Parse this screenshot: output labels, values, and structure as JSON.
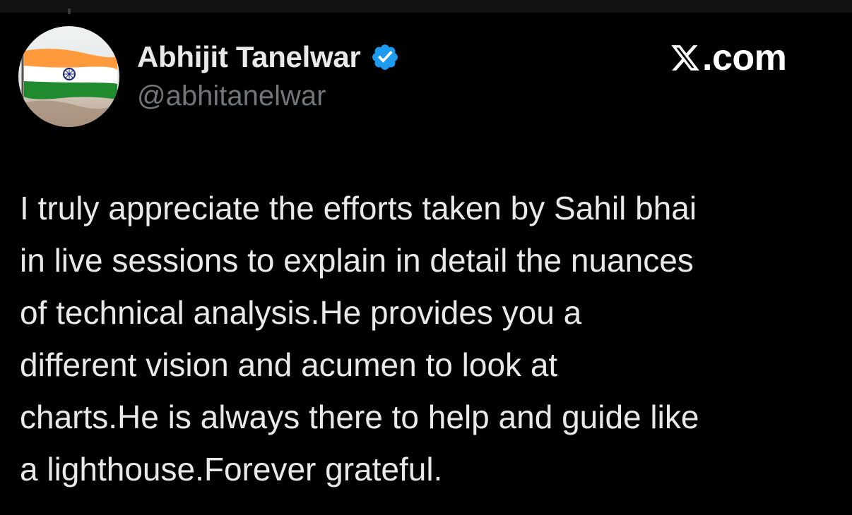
{
  "author": {
    "display_name": "Abhijit Tanelwar",
    "handle": "@abhitanelwar",
    "verified": true,
    "verified_icon": "verified-badge-icon",
    "avatar_icon": "indian-flag-avatar"
  },
  "brand": {
    "logo_icon": "x-logo-icon",
    "domain": ".com"
  },
  "post": {
    "lines": [
      "I truly appreciate the efforts taken by Sahil bhai",
      "in live sessions to explain in detail the nuances",
      "of technical analysis.He provides you a",
      "different vision and acumen to look at",
      "charts.He is always there to help and guide like",
      "a lighthouse.Forever grateful."
    ]
  },
  "colors": {
    "background": "#000000",
    "text_primary": "#e7e9ea",
    "text_secondary": "#71767b",
    "verified_blue": "#1d9bf0",
    "flag_saffron": "#ff9933",
    "flag_green": "#138808",
    "flag_chakra": "#000080"
  }
}
